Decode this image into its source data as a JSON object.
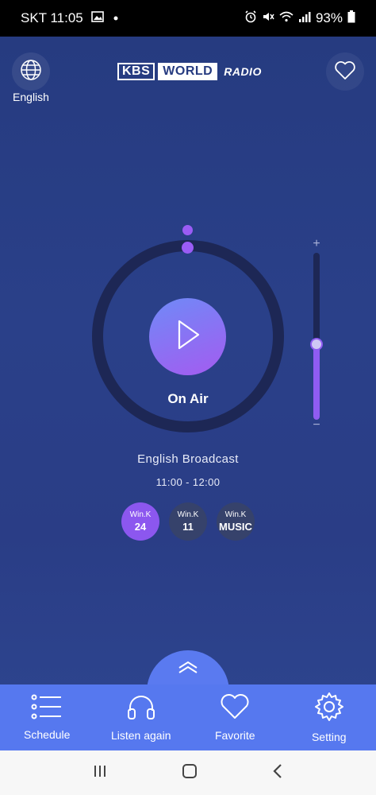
{
  "status_bar": {
    "carrier_time": "SKT 11:05",
    "battery": "93%"
  },
  "header": {
    "language_label": "English",
    "logo": {
      "part1": "KBS",
      "part2": "WORLD",
      "part3": "RADIO"
    }
  },
  "player": {
    "status": "On Air",
    "program": "English Broadcast",
    "time": "11:00 - 12:00",
    "volume_level": 0.45
  },
  "channels": [
    {
      "top": "Win.K",
      "label": "24",
      "active": true
    },
    {
      "top": "Win.K",
      "label": "11",
      "active": false
    },
    {
      "top": "Win.K",
      "label": "MUSIC",
      "active": false
    }
  ],
  "volume": {
    "plus": "+",
    "minus": "−"
  },
  "tabbar": {
    "items": [
      {
        "label": "Schedule",
        "icon": "list-icon"
      },
      {
        "label": "Listen again",
        "icon": "headphones-icon"
      },
      {
        "label": "Favorite",
        "icon": "heart-icon"
      },
      {
        "label": "Setting",
        "icon": "gear-icon"
      }
    ]
  },
  "colors": {
    "background": "#2a4089",
    "accent": "#8c57ef",
    "tabbar": "#5678ef"
  }
}
